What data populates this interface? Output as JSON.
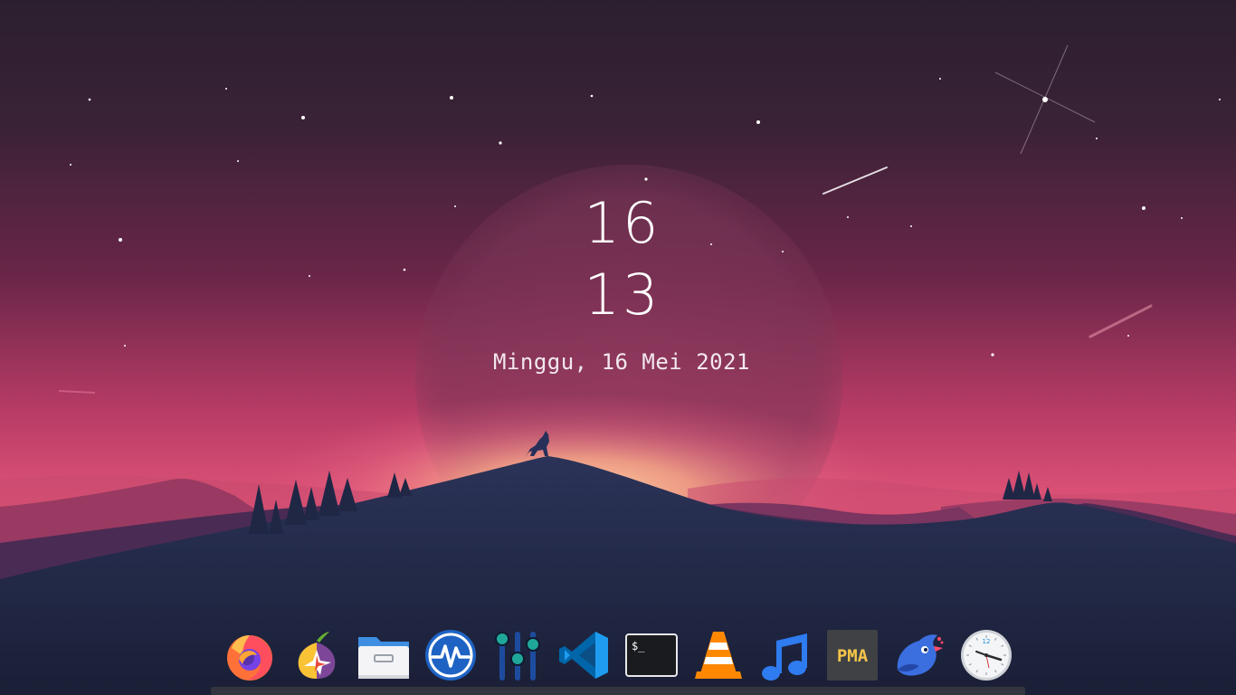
{
  "clock": {
    "hour": "16",
    "minute": "13",
    "date": "Minggu, 16 Mei 2021"
  },
  "dock": {
    "apps": [
      {
        "name": "Firefox",
        "icon": "firefox-icon"
      },
      {
        "name": "Tor Browser",
        "icon": "tor-browser-icon"
      },
      {
        "name": "Files",
        "icon": "folder-icon"
      },
      {
        "name": "System Monitor",
        "icon": "system-monitor-icon"
      },
      {
        "name": "Mixer",
        "icon": "equalizer-icon"
      },
      {
        "name": "Visual Studio Code",
        "icon": "vscode-icon"
      },
      {
        "name": "Terminal",
        "icon": "terminal-icon"
      },
      {
        "name": "VLC Media Player",
        "icon": "vlc-icon"
      },
      {
        "name": "Music",
        "icon": "music-note-icon"
      },
      {
        "name": "phpMyAdmin",
        "icon": "phpmyadmin-icon"
      },
      {
        "name": "Bird App",
        "icon": "bird-icon"
      },
      {
        "name": "Clock",
        "icon": "clock-icon"
      }
    ],
    "terminal_prompt": "$_",
    "pma_label": "PMA",
    "clock_face_number": "12"
  },
  "colors": {
    "sky_top": "#2a1f2e",
    "sky_mid": "#7a2a52",
    "sky_horizon": "#e0507a",
    "glow": "#f8b08a",
    "mountain_front": "#1e2440",
    "dock_bar": "#34363f"
  }
}
